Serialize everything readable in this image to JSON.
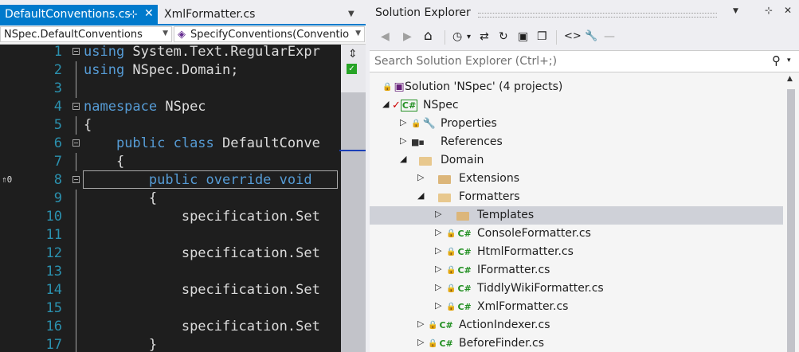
{
  "editor": {
    "tabs": {
      "active": {
        "label": "DefaultConventions.cs",
        "pin": "⊹",
        "close": "✕"
      },
      "second": {
        "label": "XmlFormatter.cs"
      },
      "overflow": "▼"
    },
    "nav": {
      "left": "NSpec.DefaultConventions",
      "right": "SpecifyConventions(Conventio",
      "arrow": "▼"
    },
    "ref_marker": "⇑0",
    "lines": [
      {
        "n": "1",
        "pre": "",
        "kw": "using",
        "post": " System.Text.RegularExpr"
      },
      {
        "n": "2",
        "pre": "",
        "kw": "using",
        "post": " NSpec.Domain;"
      },
      {
        "n": "3",
        "pre": "",
        "kw": "",
        "post": ""
      },
      {
        "n": "4",
        "pre": "",
        "kw": "namespace",
        "post": " NSpec"
      },
      {
        "n": "5",
        "pre": "",
        "kw": "",
        "post": "{"
      },
      {
        "n": "6",
        "pre": "    ",
        "kw": "public class",
        "post": " DefaultConve"
      },
      {
        "n": "7",
        "pre": "    ",
        "kw": "",
        "post": "{"
      },
      {
        "n": "8",
        "pre": "        ",
        "kw": "public override void",
        "post": ""
      },
      {
        "n": "9",
        "pre": "        ",
        "kw": "",
        "post": "{"
      },
      {
        "n": "10",
        "pre": "            ",
        "kw": "",
        "post": "specification.Set"
      },
      {
        "n": "11",
        "pre": "",
        "kw": "",
        "post": ""
      },
      {
        "n": "12",
        "pre": "            ",
        "kw": "",
        "post": "specification.Set"
      },
      {
        "n": "13",
        "pre": "",
        "kw": "",
        "post": ""
      },
      {
        "n": "14",
        "pre": "            ",
        "kw": "",
        "post": "specification.Set"
      },
      {
        "n": "15",
        "pre": "",
        "kw": "",
        "post": ""
      },
      {
        "n": "16",
        "pre": "            ",
        "kw": "",
        "post": "specification.Set"
      },
      {
        "n": "17",
        "pre": "        ",
        "kw": "",
        "post": "}"
      }
    ],
    "scroll": {
      "split": "⇕",
      "check": "✓"
    }
  },
  "solution_explorer": {
    "title": "Solution Explorer",
    "title_buttons": {
      "dropdown": "▼",
      "pin": "⊹",
      "close": "✕"
    },
    "toolbar": {
      "back": "◀",
      "forward": "▶",
      "home": "⌂",
      "history": "◷",
      "history_caret": "▾",
      "sync": "⇄",
      "refresh": "↻",
      "collapse": "▣",
      "copy": "❐",
      "code": "<>",
      "properties": "🔧",
      "preview": "—"
    },
    "search": {
      "placeholder": "Search Solution Explorer (Ctrl+;)",
      "icon": "⚲",
      "caret": "▾"
    },
    "tree": [
      {
        "label": "Solution 'NSpec' (4 projects)"
      },
      {
        "label": "NSpec",
        "exp": "◢",
        "badge": "C#"
      },
      {
        "label": "Properties",
        "exp": "▷"
      },
      {
        "label": "References",
        "exp": "▷",
        "icon": "■▪"
      },
      {
        "label": "Domain",
        "exp": "◢"
      },
      {
        "label": "Extensions",
        "exp": "▷"
      },
      {
        "label": "Formatters",
        "exp": "◢"
      },
      {
        "label": "Templates",
        "exp": "▷"
      },
      {
        "label": "ConsoleFormatter.cs",
        "exp": "▷",
        "badge": "C#"
      },
      {
        "label": "HtmlFormatter.cs",
        "exp": "▷",
        "badge": "C#"
      },
      {
        "label": "IFormatter.cs",
        "exp": "▷",
        "badge": "C#"
      },
      {
        "label": "TiddlyWikiFormatter.cs",
        "exp": "▷",
        "badge": "C#"
      },
      {
        "label": "XmlFormatter.cs",
        "exp": "▷",
        "badge": "C#"
      },
      {
        "label": "ActionIndexer.cs",
        "exp": "▷",
        "badge": "C#"
      },
      {
        "label": "BeforeFinder.cs",
        "exp": "▷",
        "badge": "C#"
      }
    ],
    "scroll_up": "▲"
  },
  "colors": {
    "accent": "#007acc",
    "editor_bg": "#1e1e1e",
    "keyword": "#569cd6",
    "line_number": "#2b91af",
    "folder": "#dcb67a",
    "csharp": "#239023"
  }
}
